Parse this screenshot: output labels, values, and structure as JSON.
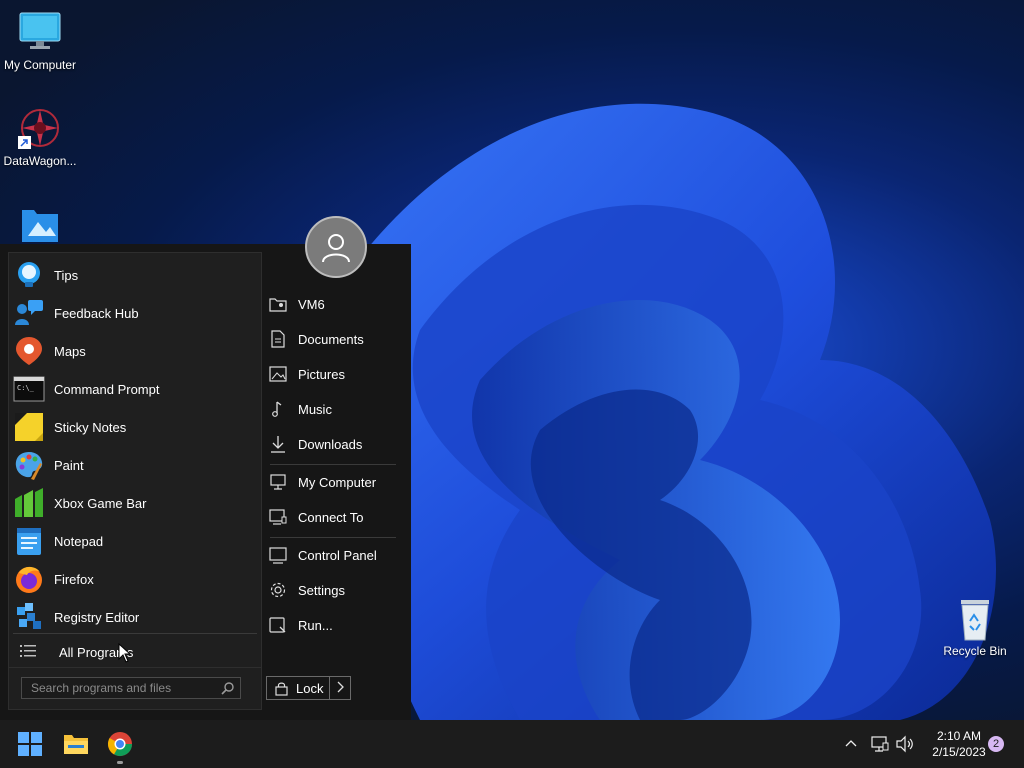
{
  "desktop": {
    "icons": [
      {
        "label": "My Computer",
        "icon": "monitor-icon"
      },
      {
        "label": "DataWagon...",
        "icon": "datawagon-shortcut-icon"
      },
      {
        "label": "",
        "icon": "folder-pictures-icon"
      },
      {
        "label": "Recycle Bin",
        "icon": "recycle-bin-icon"
      }
    ]
  },
  "start_menu": {
    "programs": [
      {
        "label": "Tips",
        "icon": "tips-bulb-icon"
      },
      {
        "label": "Feedback Hub",
        "icon": "feedback-hub-icon"
      },
      {
        "label": "Maps",
        "icon": "maps-pin-icon"
      },
      {
        "label": "Command Prompt",
        "icon": "command-prompt-icon"
      },
      {
        "label": "Sticky Notes",
        "icon": "sticky-notes-icon"
      },
      {
        "label": "Paint",
        "icon": "paint-palette-icon"
      },
      {
        "label": "Xbox Game Bar",
        "icon": "xbox-game-bar-icon"
      },
      {
        "label": "Notepad",
        "icon": "notepad-icon"
      },
      {
        "label": "Firefox",
        "icon": "firefox-icon"
      },
      {
        "label": "Registry Editor",
        "icon": "registry-editor-icon"
      }
    ],
    "all_programs": "All Programs",
    "search_placeholder": "Search programs and files",
    "right_items": [
      {
        "label": "VM6",
        "icon": "user-folder-icon"
      },
      {
        "label": "Documents",
        "icon": "document-icon"
      },
      {
        "label": "Pictures",
        "icon": "picture-icon"
      },
      {
        "label": "Music",
        "icon": "music-note-icon"
      },
      {
        "label": "Downloads",
        "icon": "download-arrow-icon"
      },
      {
        "label": "My Computer",
        "icon": "computer-icon"
      },
      {
        "label": "Connect To",
        "icon": "connect-to-icon"
      },
      {
        "label": "Control Panel",
        "icon": "control-panel-icon"
      },
      {
        "label": "Settings",
        "icon": "gear-icon"
      },
      {
        "label": "Run...",
        "icon": "run-icon"
      }
    ],
    "lock_label": "Lock"
  },
  "taskbar": {
    "time": "2:10 AM",
    "date": "2/15/2023",
    "notification_count": "2"
  }
}
